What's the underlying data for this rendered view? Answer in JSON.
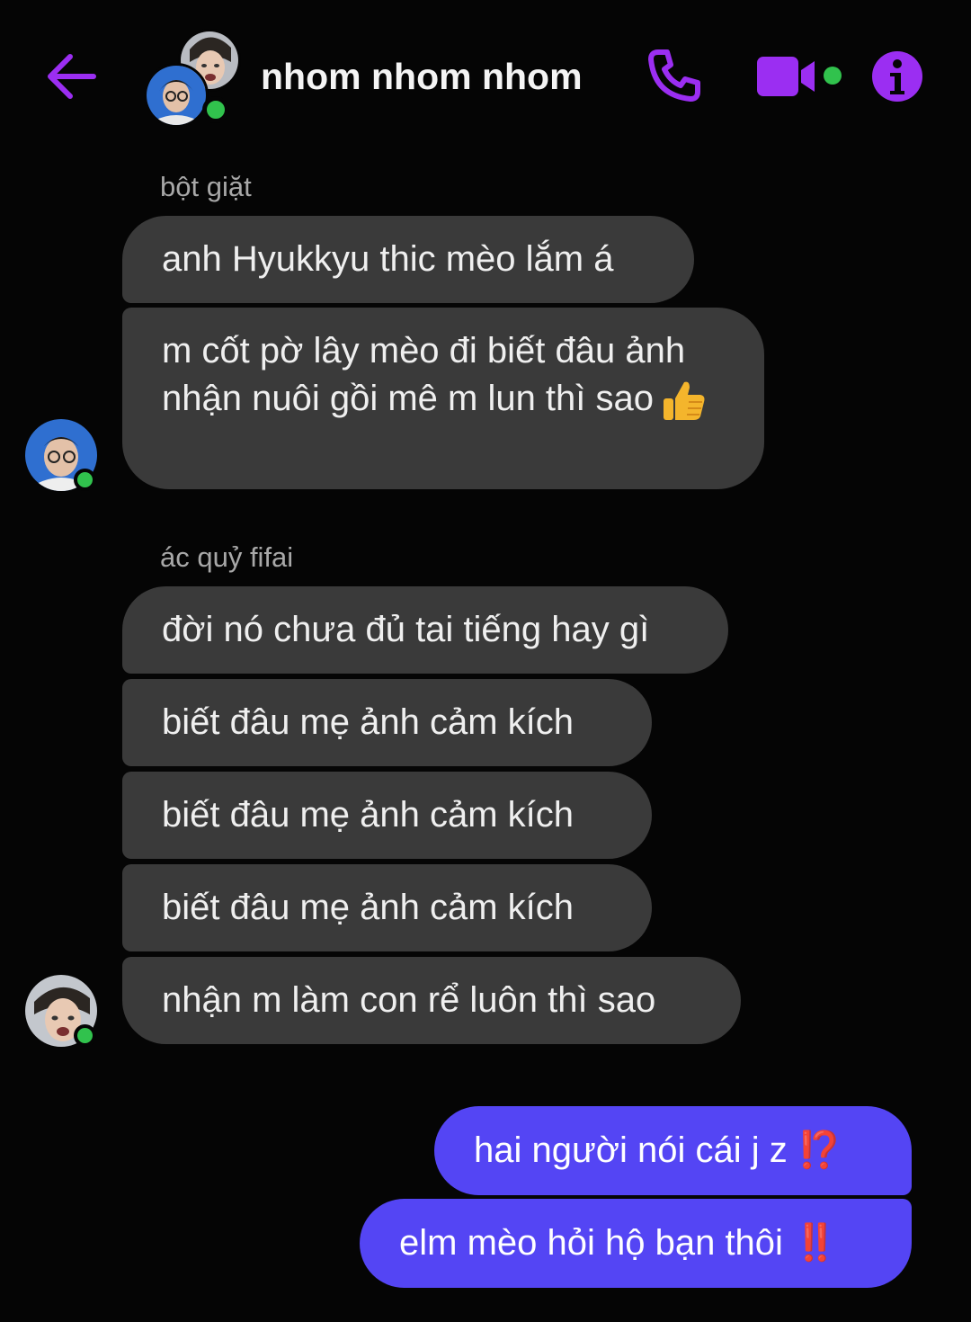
{
  "header": {
    "title": "nhom nhom nhom",
    "accent_color": "#9b2ef2",
    "online_color": "#31c24d"
  },
  "conversation": [
    {
      "sender": "bột giặt",
      "messages": [
        "anh Hyukkyu thic mèo lắm á",
        "m cốt pờ lây mèo đi biết đâu ảnh nhận nuôi gồi mê m lun thì sao"
      ],
      "emoji": "thumbs-up"
    },
    {
      "sender": "ác quỷ fifai",
      "messages": [
        "đời nó chưa đủ tai tiếng hay gì",
        "biết đâu mẹ ảnh cảm kích",
        "biết đâu mẹ ảnh cảm kích",
        "biết đâu mẹ ảnh cảm kích",
        "nhận m làm con rể luôn thì sao"
      ]
    }
  ],
  "my_messages": [
    {
      "text": "hai người nói cái j z",
      "emoji": "⁉️"
    },
    {
      "text": "elm mèo hỏi hộ bạn thôi",
      "emoji": "‼️"
    }
  ],
  "colors": {
    "background": "#050505",
    "incoming_bubble": "#3a3a3a",
    "outgoing_bubble": "#5445f4"
  }
}
